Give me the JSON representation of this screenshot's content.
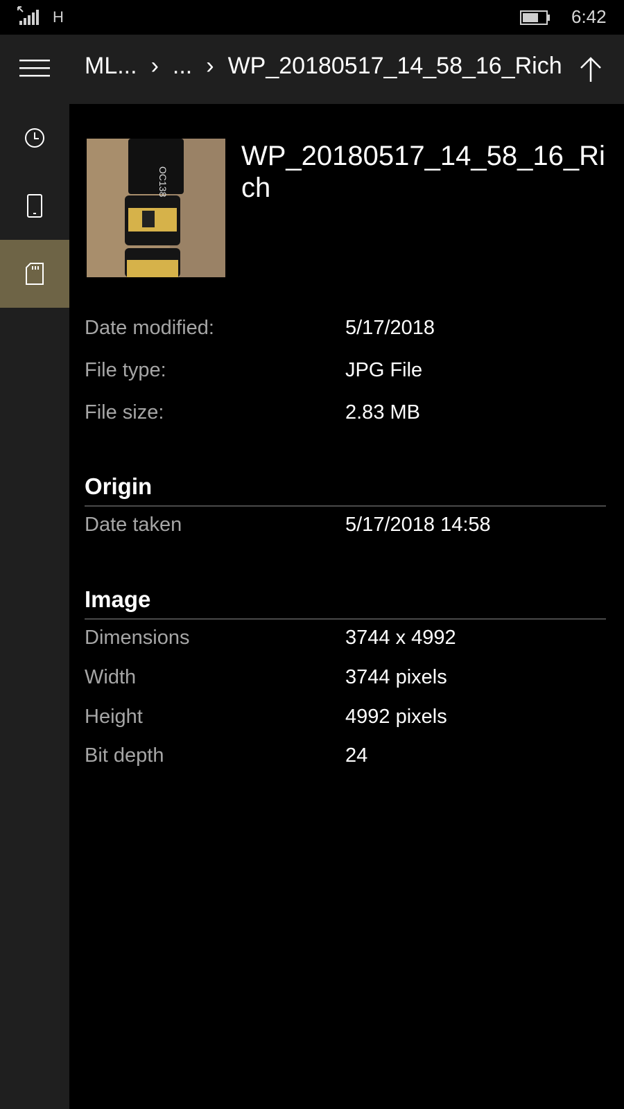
{
  "status_bar": {
    "network": "H",
    "time": "6:42",
    "battery_level": 0.7
  },
  "breadcrumb": {
    "items": [
      "ML...",
      "...",
      "WP_20180517_14_58_16_Rich"
    ]
  },
  "sidebar": {
    "items": [
      {
        "icon": "menu-icon"
      },
      {
        "icon": "clock-icon"
      },
      {
        "icon": "phone-icon"
      },
      {
        "icon": "sd-card-icon",
        "active": true
      }
    ]
  },
  "file": {
    "name": "WP_20180517_14_58_16_Rich"
  },
  "properties": {
    "date_modified_label": "Date modified:",
    "date_modified": "5/17/2018",
    "file_type_label": "File type:",
    "file_type": "JPG File",
    "file_size_label": "File size:",
    "file_size": "2.83 MB"
  },
  "origin": {
    "heading": "Origin",
    "date_taken_label": "Date taken",
    "date_taken": "5/17/2018 14:58"
  },
  "image": {
    "heading": "Image",
    "dimensions_label": "Dimensions",
    "dimensions": "3744 x 4992",
    "width_label": "Width",
    "width": "3744 pixels",
    "height_label": "Height",
    "height": "4992 pixels",
    "bit_depth_label": "Bit depth",
    "bit_depth": "24"
  },
  "thumbnail_text": "OC138",
  "colors": {
    "sidebar_bg": "#1f1f1f",
    "active_accent": "#6e6446"
  }
}
